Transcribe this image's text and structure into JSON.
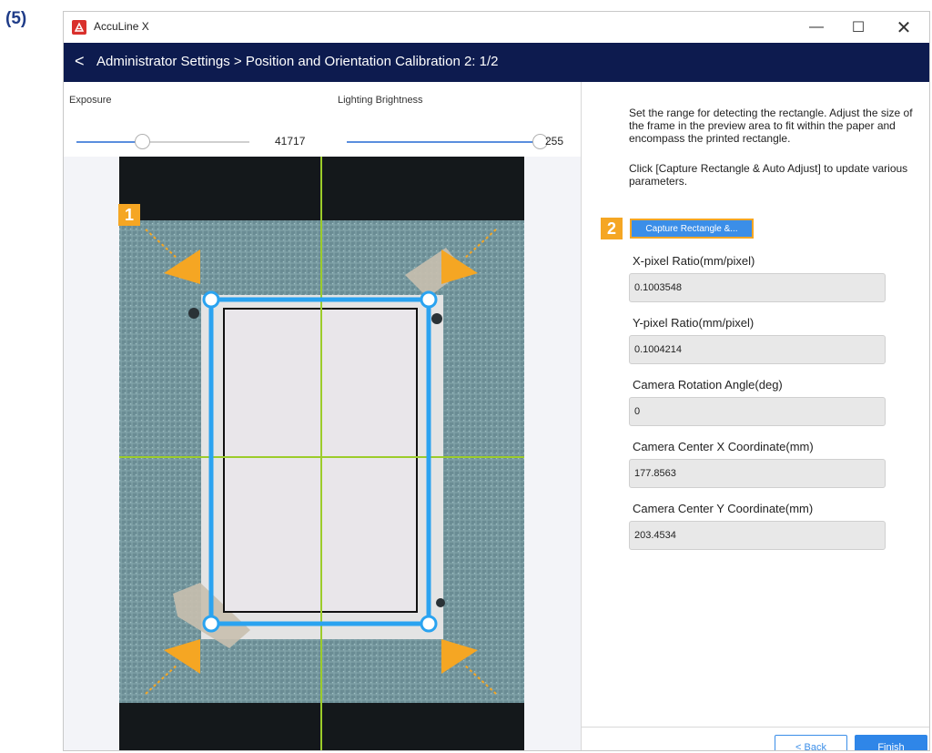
{
  "step_label": "(5)",
  "window": {
    "app_title": "AccuLine X",
    "minimize_glyph": "—",
    "maximize_glyph": "☐",
    "close_glyph": "✕"
  },
  "nav": {
    "back_glyph": "<",
    "breadcrumb": "Administrator Settings > Position and Orientation Calibration 2: 1/2"
  },
  "sliders": {
    "exposure": {
      "label": "Exposure",
      "value": "41717",
      "level_fraction": 0.38
    },
    "lighting": {
      "label": "Lighting Brightness",
      "value": "255",
      "level_fraction": 1.0
    }
  },
  "instructions": {
    "p1": "Set the range for detecting the rectangle. Adjust the size of the frame in the preview area to fit within the paper and encompass the printed rectangle.",
    "p2": "Click [Capture Rectangle & Auto Adjust] to update various parameters."
  },
  "badges": {
    "one": "1",
    "two": "2"
  },
  "capture_button": {
    "label": "Capture Rectangle &..."
  },
  "fields": [
    {
      "label": "X-pixel Ratio(mm/pixel)",
      "value": "0.1003548"
    },
    {
      "label": "Y-pixel Ratio(mm/pixel)",
      "value": "0.1004214"
    },
    {
      "label": "Camera Rotation Angle(deg)",
      "value": "0"
    },
    {
      "label": "Camera Center X Coordinate(mm)",
      "value": "177.8563"
    },
    {
      "label": "Camera Center Y Coordinate(mm)",
      "value": "203.4534"
    }
  ],
  "footer": {
    "back_label": "< Back",
    "finish_label": "Finish"
  },
  "colors": {
    "nav_bg": "#0d1b4f",
    "accent_blue": "#3b8ee8",
    "frame_blue": "#2aa3f0",
    "crosshair_green": "#9ccc2a",
    "annotation_orange": "#f5a623"
  },
  "icons": {
    "app": "acculine-app-icon",
    "back": "chevron-left-icon",
    "corner_handle": "circle-handle-icon",
    "pointer": "orange-arrow-icon"
  }
}
